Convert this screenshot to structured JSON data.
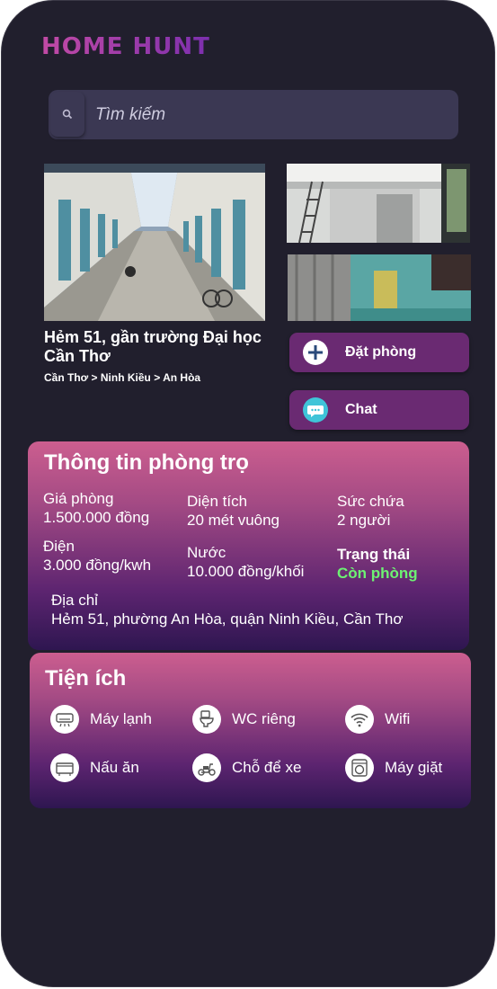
{
  "app": {
    "logo": "HOME HUNT"
  },
  "search": {
    "placeholder": "Tìm kiếm"
  },
  "listing": {
    "title": "Hẻm 51, gần trường Đại học Cần Thơ",
    "breadcrumb": "Cần Thơ > Ninh Kiều > An Hòa"
  },
  "actions": {
    "book_label": "Đặt phòng",
    "chat_label": "Chat"
  },
  "info": {
    "heading": "Thông tin phòng trọ",
    "price_label": "Giá phòng",
    "price_value": "1.500.000 đồng",
    "area_label": "Diện tích",
    "area_value": "20 mét vuông",
    "capacity_label": "Sức chứa",
    "capacity_value": "2 người",
    "electric_label": "Điện",
    "electric_value": "3.000 đồng/kwh",
    "water_label": "Nước",
    "water_value": "10.000 đồng/khối",
    "status_label": "Trạng thái",
    "status_value": "Còn phòng",
    "address_label": "Địa chỉ",
    "address_value": "Hẻm 51, phường An Hòa, quận Ninh Kiều, Cần Thơ"
  },
  "amenities": {
    "heading": "Tiện ích",
    "items": [
      {
        "label": "Máy lạnh",
        "icon": "air-conditioner-icon"
      },
      {
        "label": "WC riêng",
        "icon": "toilet-icon"
      },
      {
        "label": "Wifi",
        "icon": "wifi-icon"
      },
      {
        "label": "Nấu ăn",
        "icon": "stove-icon"
      },
      {
        "label": "Chỗ để xe",
        "icon": "scooter-icon"
      },
      {
        "label": "Máy giặt",
        "icon": "washing-machine-icon"
      }
    ]
  },
  "colors": {
    "accent": "#6a2a72",
    "available": "#6df273",
    "background": "#211f2d"
  }
}
